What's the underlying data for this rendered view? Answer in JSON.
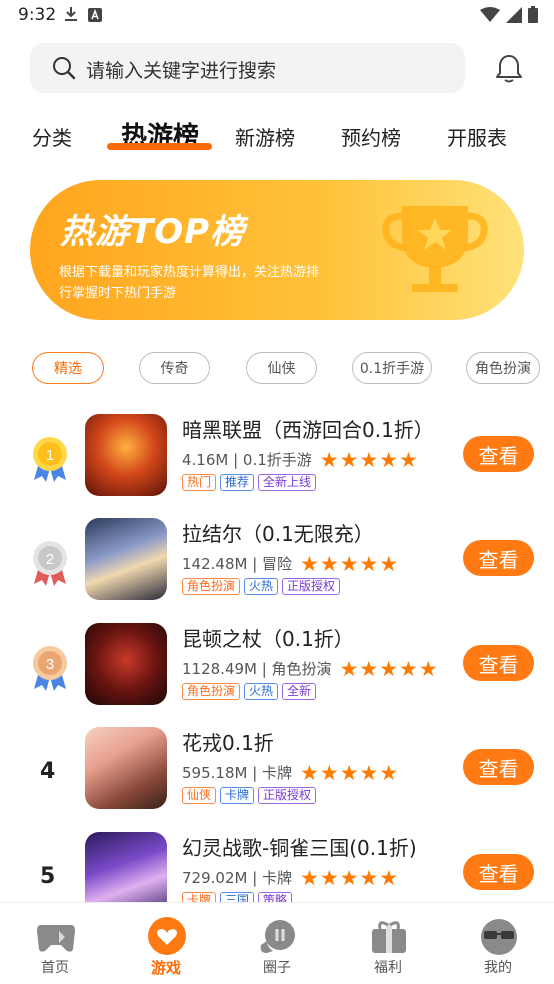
{
  "status_bar": {
    "time": "9:32"
  },
  "search": {
    "placeholder": "请输入关键字进行搜索"
  },
  "tabs": [
    "分类",
    "热游榜",
    "新游榜",
    "预约榜",
    "开服表"
  ],
  "banner": {
    "title": "热游TOP榜",
    "description": "根据下载量和玩家热度计算得出，关注热游排行掌握时下热门手游"
  },
  "chips": [
    "精选",
    "传奇",
    "仙侠",
    "0.1折手游",
    "角色扮演"
  ],
  "view_label": "查看",
  "games": [
    {
      "rank": "1",
      "name": "暗黑联盟（西游回合0.1折）",
      "meta": "4.16M | 0.1折手游",
      "rating": 5,
      "tags": [
        "热门",
        "推荐",
        "全新上线"
      ]
    },
    {
      "rank": "2",
      "name": "拉结尔（0.1无限充）",
      "meta": "142.48M | 冒险",
      "rating": 5,
      "tags": [
        "角色扮演",
        "火热",
        "正版授权"
      ]
    },
    {
      "rank": "3",
      "name": "昆顿之杖（0.1折）",
      "meta": "1128.49M | 角色扮演",
      "rating": 5,
      "tags": [
        "角色扮演",
        "火热",
        "全新"
      ]
    },
    {
      "rank": "4",
      "name": "花戎0.1折",
      "meta": "595.18M | 卡牌",
      "rating": 5,
      "tags": [
        "仙侠",
        "卡牌",
        "正版授权"
      ]
    },
    {
      "rank": "5",
      "name": "幻灵战歌-铜雀三国(0.1折)",
      "meta": "729.02M | 卡牌",
      "rating": 5,
      "tags": [
        "卡牌",
        "三国",
        "策略"
      ]
    }
  ],
  "bottom_nav": [
    "首页",
    "游戏",
    "圈子",
    "福利",
    "我的"
  ],
  "colors": {
    "accent": "#ff7a12",
    "active_text": "#ff6a00"
  }
}
